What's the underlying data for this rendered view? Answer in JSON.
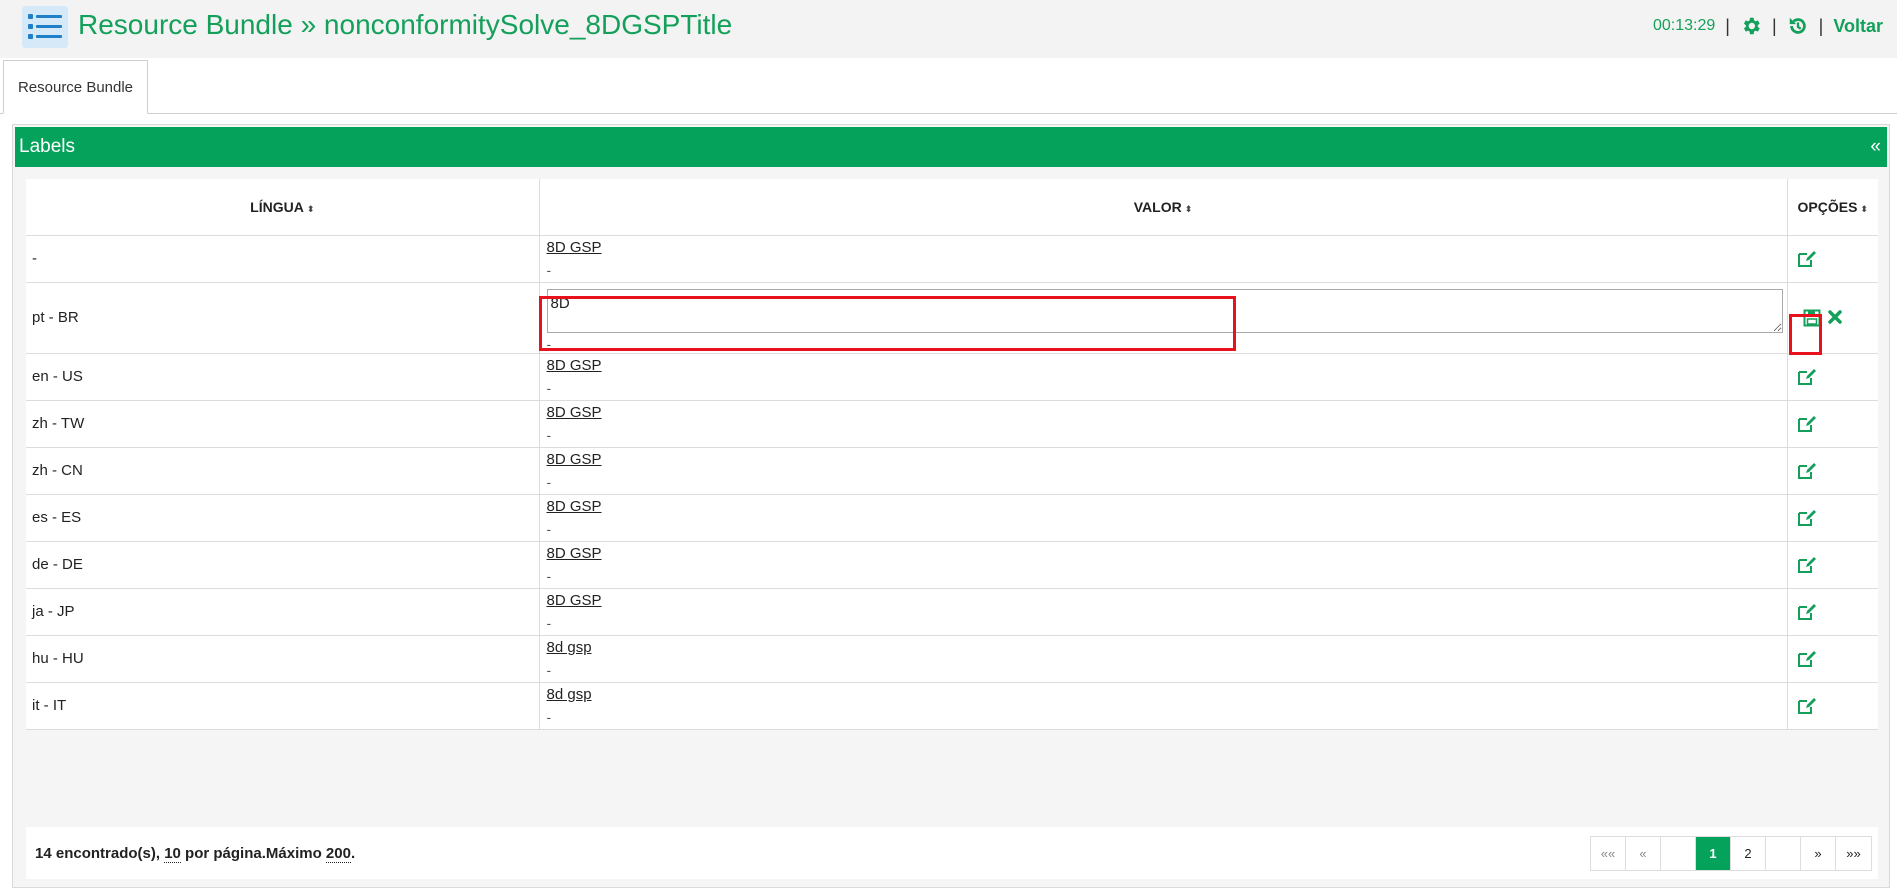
{
  "header": {
    "title": "Resource Bundle » nonconformitySolve_8DGSPTitle",
    "clock": "00:13:29",
    "back_label": "Voltar",
    "separator": "|"
  },
  "tabs": [
    {
      "label": "Resource Bundle"
    }
  ],
  "panel": {
    "title": "Labels",
    "collapse_glyph": "«"
  },
  "table": {
    "columns": [
      "LÍNGUA",
      "VALOR",
      "OPÇÕES"
    ],
    "sort_glyph": "⬍",
    "rows": [
      {
        "lang": "-",
        "value": "8D GSP",
        "sub": "-"
      },
      {
        "lang": "pt - BR",
        "value": "8D",
        "sub": "-",
        "editing": true
      },
      {
        "lang": "en - US",
        "value": "8D GSP",
        "sub": "-"
      },
      {
        "lang": "zh - TW",
        "value": "8D GSP",
        "sub": "-"
      },
      {
        "lang": "zh - CN",
        "value": "8D GSP",
        "sub": "-"
      },
      {
        "lang": "es - ES",
        "value": "8D GSP",
        "sub": "-"
      },
      {
        "lang": "de - DE",
        "value": "8D GSP",
        "sub": "-"
      },
      {
        "lang": "ja - JP",
        "value": "8D GSP",
        "sub": "-"
      },
      {
        "lang": "hu - HU",
        "value": "8d gsp",
        "sub": "-"
      },
      {
        "lang": "it - IT",
        "value": "8d gsp",
        "sub": "-"
      }
    ]
  },
  "footer": {
    "found_count": "14",
    "found_label": " encontrado(s), ",
    "per_page": "10",
    "per_page_label": " por página.Máximo ",
    "max": "200",
    "period": "."
  },
  "pager": {
    "first": "««",
    "prev": "«",
    "pages": [
      "1",
      "2"
    ],
    "next": "»",
    "last": "»»"
  },
  "colors": {
    "accent": "#04a25a",
    "highlight": "#e8111e"
  }
}
